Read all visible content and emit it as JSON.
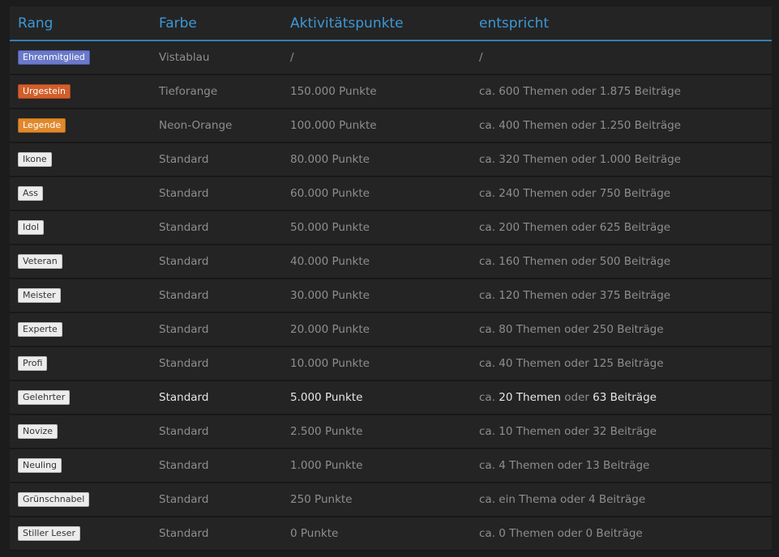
{
  "headers": [
    "Rang",
    "Farbe",
    "Aktivitätspunkte",
    "entspricht"
  ],
  "colors": {
    "vistablau": "#6b79c9",
    "tieforange": "#d15f2b",
    "neon_orange": "#e0892c",
    "header": "#3e97d6"
  },
  "rows": [
    {
      "rank": "Ehrenmitglied",
      "color": "Vistablau",
      "points": "/",
      "equiv": "/"
    },
    {
      "rank": "Urgestein",
      "color": "Tieforange",
      "points": "150.000 Punkte",
      "equiv": "ca. 600 Themen oder 1.875 Beiträge"
    },
    {
      "rank": "Legende",
      "color": "Neon-Orange",
      "points": "100.000 Punkte",
      "equiv": "ca. 400 Themen oder 1.250 Beiträge"
    },
    {
      "rank": "Ikone",
      "color": "Standard",
      "points": "80.000 Punkte",
      "equiv": "ca. 320 Themen oder 1.000 Beiträge"
    },
    {
      "rank": "Ass",
      "color": "Standard",
      "points": "60.000 Punkte",
      "equiv": "ca. 240 Themen oder 750 Beiträge"
    },
    {
      "rank": "Idol",
      "color": "Standard",
      "points": "50.000 Punkte",
      "equiv": "ca. 200 Themen oder 625 Beiträge"
    },
    {
      "rank": "Veteran",
      "color": "Standard",
      "points": "40.000 Punkte",
      "equiv": "ca. 160 Themen oder 500 Beiträge"
    },
    {
      "rank": "Meister",
      "color": "Standard",
      "points": "30.000 Punkte",
      "equiv": "ca. 120 Themen oder 375 Beiträge"
    },
    {
      "rank": "Experte",
      "color": "Standard",
      "points": "20.000 Punkte",
      "equiv": "ca. 80 Themen oder 250 Beiträge"
    },
    {
      "rank": "Profi",
      "color": "Standard",
      "points": "10.000 Punkte",
      "equiv": "ca. 40 Themen oder 125 Beiträge"
    },
    {
      "rank": "Gelehrter",
      "color": "Standard",
      "points": "5.000 Punkte",
      "equiv_parts": [
        "ca.",
        "20 Themen",
        "oder",
        "63 Beiträge"
      ]
    },
    {
      "rank": "Novize",
      "color": "Standard",
      "points": "2.500 Punkte",
      "equiv": "ca. 10 Themen oder 32 Beiträge"
    },
    {
      "rank": "Neuling",
      "color": "Standard",
      "points": "1.000 Punkte",
      "equiv": "ca. 4 Themen oder 13 Beiträge"
    },
    {
      "rank": "Grünschnabel",
      "color": "Standard",
      "points": "250 Punkte",
      "equiv": "ca. ein Thema oder 4 Beiträge"
    },
    {
      "rank": "Stiller Leser",
      "color": "Standard",
      "points": "0 Punkte",
      "equiv": "ca. 0 Themen oder 0 Beiträge"
    }
  ]
}
